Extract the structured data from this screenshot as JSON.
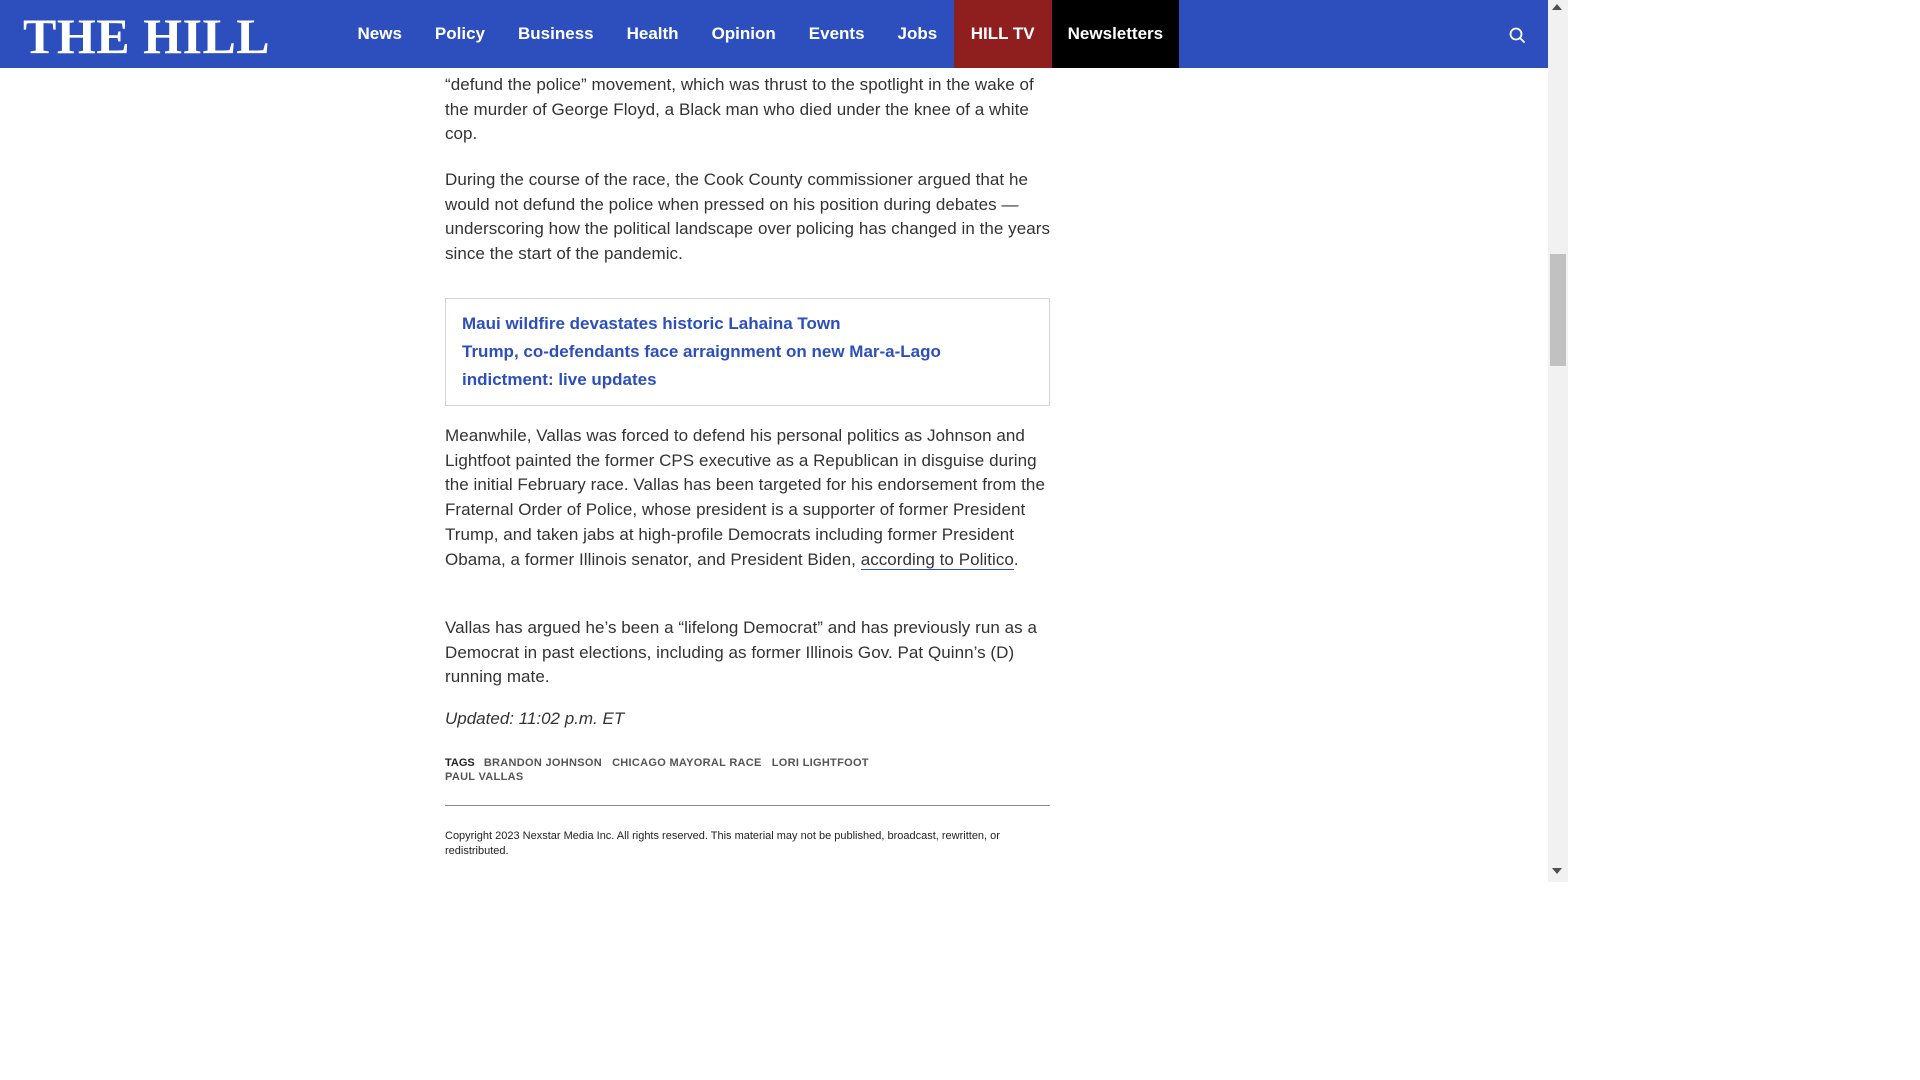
{
  "header": {
    "logo": "THE HILL",
    "nav": [
      {
        "label": "News"
      },
      {
        "label": "Policy"
      },
      {
        "label": "Business"
      },
      {
        "label": "Health"
      },
      {
        "label": "Opinion"
      },
      {
        "label": "Events"
      },
      {
        "label": "Jobs"
      },
      {
        "label": "HILL TV"
      },
      {
        "label": "Newsletters"
      }
    ],
    "search_icon": "search-icon"
  },
  "article": {
    "para1": "“defund the police” movement, which was thrust to the spotlight in the wake of the murder of George Floyd, a Black man who died under the knee of a white cop.",
    "para2": "During the course of the race, the Cook County commissioner argued that he would not defund the police when pressed on his position during debates — underscoring how the political landscape over policing has changed in the years since the start of the pandemic.",
    "related": [
      "Maui wildfire devastates historic Lahaina Town",
      "Trump, co-defendants face arraignment on new Mar-a-Lago indictment: live updates"
    ],
    "para3_text": "Meanwhile, Vallas was forced to defend his personal politics as Johnson and Lightfoot painted the former CPS executive as a Republican in disguise during the initial February race. Vallas has been targeted for his endorsement from the Fraternal Order of Police, whose president is a supporter of former President Trump, and taken jabs at high-profile Democrats including former President Obama, a former Illinois senator, and President Biden, ",
    "para3_link": "according to Politico",
    "para3_end": ".",
    "para4": "Vallas has argued he’s been a “lifelong Democrat” and has previously run as a Democrat in past elections, including as former Illinois Gov. Pat Quinn’s (D) running mate.",
    "updated": "Updated: 11:02 p.m. ET"
  },
  "tags": {
    "label": "TAGS",
    "items": [
      "BRANDON JOHNSON",
      "CHICAGO MAYORAL RACE",
      "LORI LIGHTFOOT",
      "PAUL VALLAS"
    ]
  },
  "footer": {
    "copyright": "Copyright 2023 Nexstar Media Inc. All rights reserved. This material may not be published, broadcast, rewritten, or redistributed."
  },
  "colors": {
    "header_bg": "#2c4fbd",
    "hill_tv_bg": "#8f1f1f",
    "newsletters_bg": "#000000",
    "link": "#2c4fbd"
  }
}
